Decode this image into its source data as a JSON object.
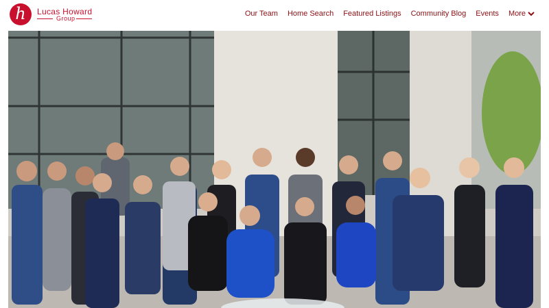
{
  "brand": {
    "name": "Lucas Howard",
    "sub": "Group",
    "mark": "h",
    "color": "#c8102e"
  },
  "nav": {
    "items": [
      {
        "label": "Our Team"
      },
      {
        "label": "Home Search"
      },
      {
        "label": "Featured Listings"
      },
      {
        "label": "Community Blog"
      },
      {
        "label": "Events"
      }
    ],
    "more_label": "More",
    "color": "#8b0f14"
  },
  "hero": {
    "icon": "team-photo"
  }
}
